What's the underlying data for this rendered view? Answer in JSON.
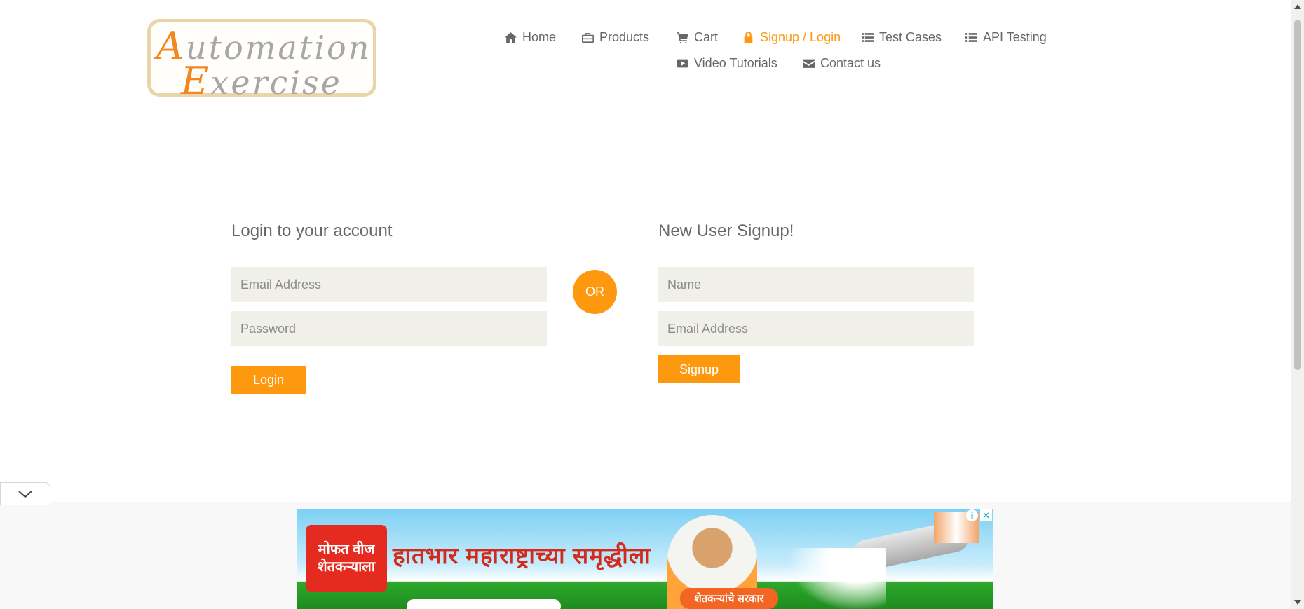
{
  "brand": {
    "logo_line1_cap": "A",
    "logo_line1_rest": "utomation",
    "logo_line2_cap": "E",
    "logo_line2_rest": "xercise"
  },
  "nav": {
    "items": [
      {
        "label": "Home",
        "icon": "home-icon"
      },
      {
        "label": "Products",
        "icon": "briefcase-icon"
      },
      {
        "label": "Cart",
        "icon": "cart-icon"
      },
      {
        "label": "Signup / Login",
        "icon": "lock-icon",
        "active": true
      },
      {
        "label": "Test Cases",
        "icon": "list-icon"
      },
      {
        "label": "API Testing",
        "icon": "list-icon"
      },
      {
        "label": "Video Tutorials",
        "icon": "youtube-play-icon"
      },
      {
        "label": "Contact us",
        "icon": "envelope-icon"
      }
    ],
    "active_color": "#fe980f"
  },
  "login": {
    "title": "Login to your account",
    "email_placeholder": "Email Address",
    "email_value": "",
    "password_placeholder": "Password",
    "password_value": "",
    "button_label": "Login"
  },
  "separator": {
    "label": "OR"
  },
  "signup": {
    "title": "New User Signup!",
    "name_placeholder": "Name",
    "name_value": "",
    "email_placeholder": "Email Address",
    "email_value": "",
    "button_label": "Signup"
  },
  "ad": {
    "badge_text_line1": "मोफत वीज",
    "badge_text_line2": "शेतकऱ्याला",
    "headline": "हातभार महाराष्ट्राच्या समृद्धीला",
    "sub_badge": "शेतकऱ्यांचे सरकार",
    "info_icon": "info-icon",
    "close_icon": "close-icon",
    "collapse_icon": "chevron-down-icon"
  },
  "colors": {
    "accent": "#fe980f",
    "input_bg": "#f0f0e9",
    "text": "#696763"
  }
}
